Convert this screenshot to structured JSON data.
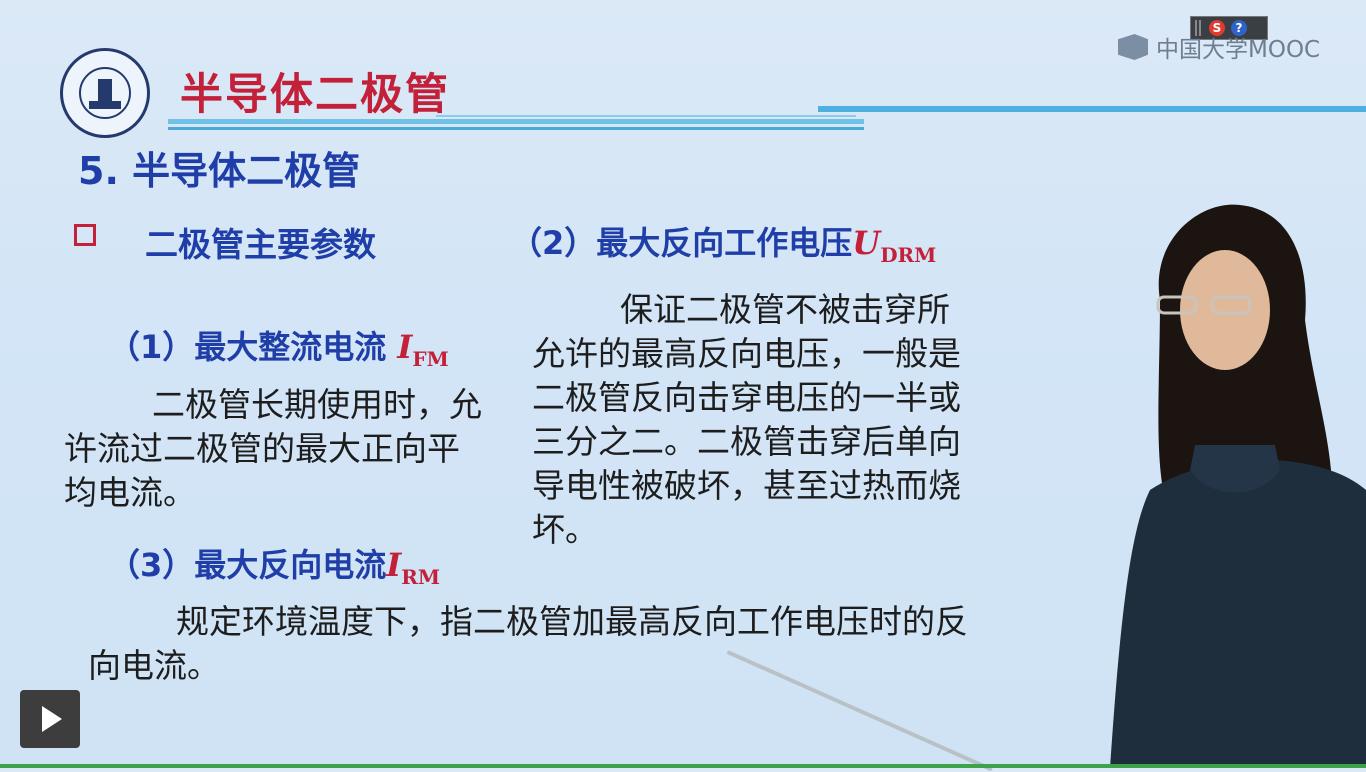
{
  "header": {
    "title": "半导体二极管",
    "brand": "中国大学MOOC"
  },
  "slide": {
    "section_title": "5. 半导体二极管",
    "params_heading": "二极管主要参数",
    "item1": {
      "label": "（1）最大整流电流 ",
      "symbol": "I",
      "subscript": "FM"
    },
    "item1_text": "二极管长期使用时，允许流过二极管的最大正向平均电流。",
    "item2": {
      "label": "（2）最大反向工作电压",
      "symbol": "U",
      "subscript": "DRM"
    },
    "item2_text": "保证二极管不被击穿所允许的最高反向电压，一般是二极管反向击穿电压的一半或三分之二。二极管击穿后单向导电性被破坏，甚至过热而烧坏。",
    "item3": {
      "label": "（3）最大反向电流",
      "symbol": "I",
      "subscript": "RM"
    },
    "item3_text": "规定环境温度下，指二极管加最高反向工作电压时的反向电流。"
  },
  "player": {
    "play_icon": "play-icon",
    "progress_color": "#3ca34a"
  },
  "colors": {
    "accent_red": "#c3203a",
    "heading_blue": "#1f3ea8"
  }
}
